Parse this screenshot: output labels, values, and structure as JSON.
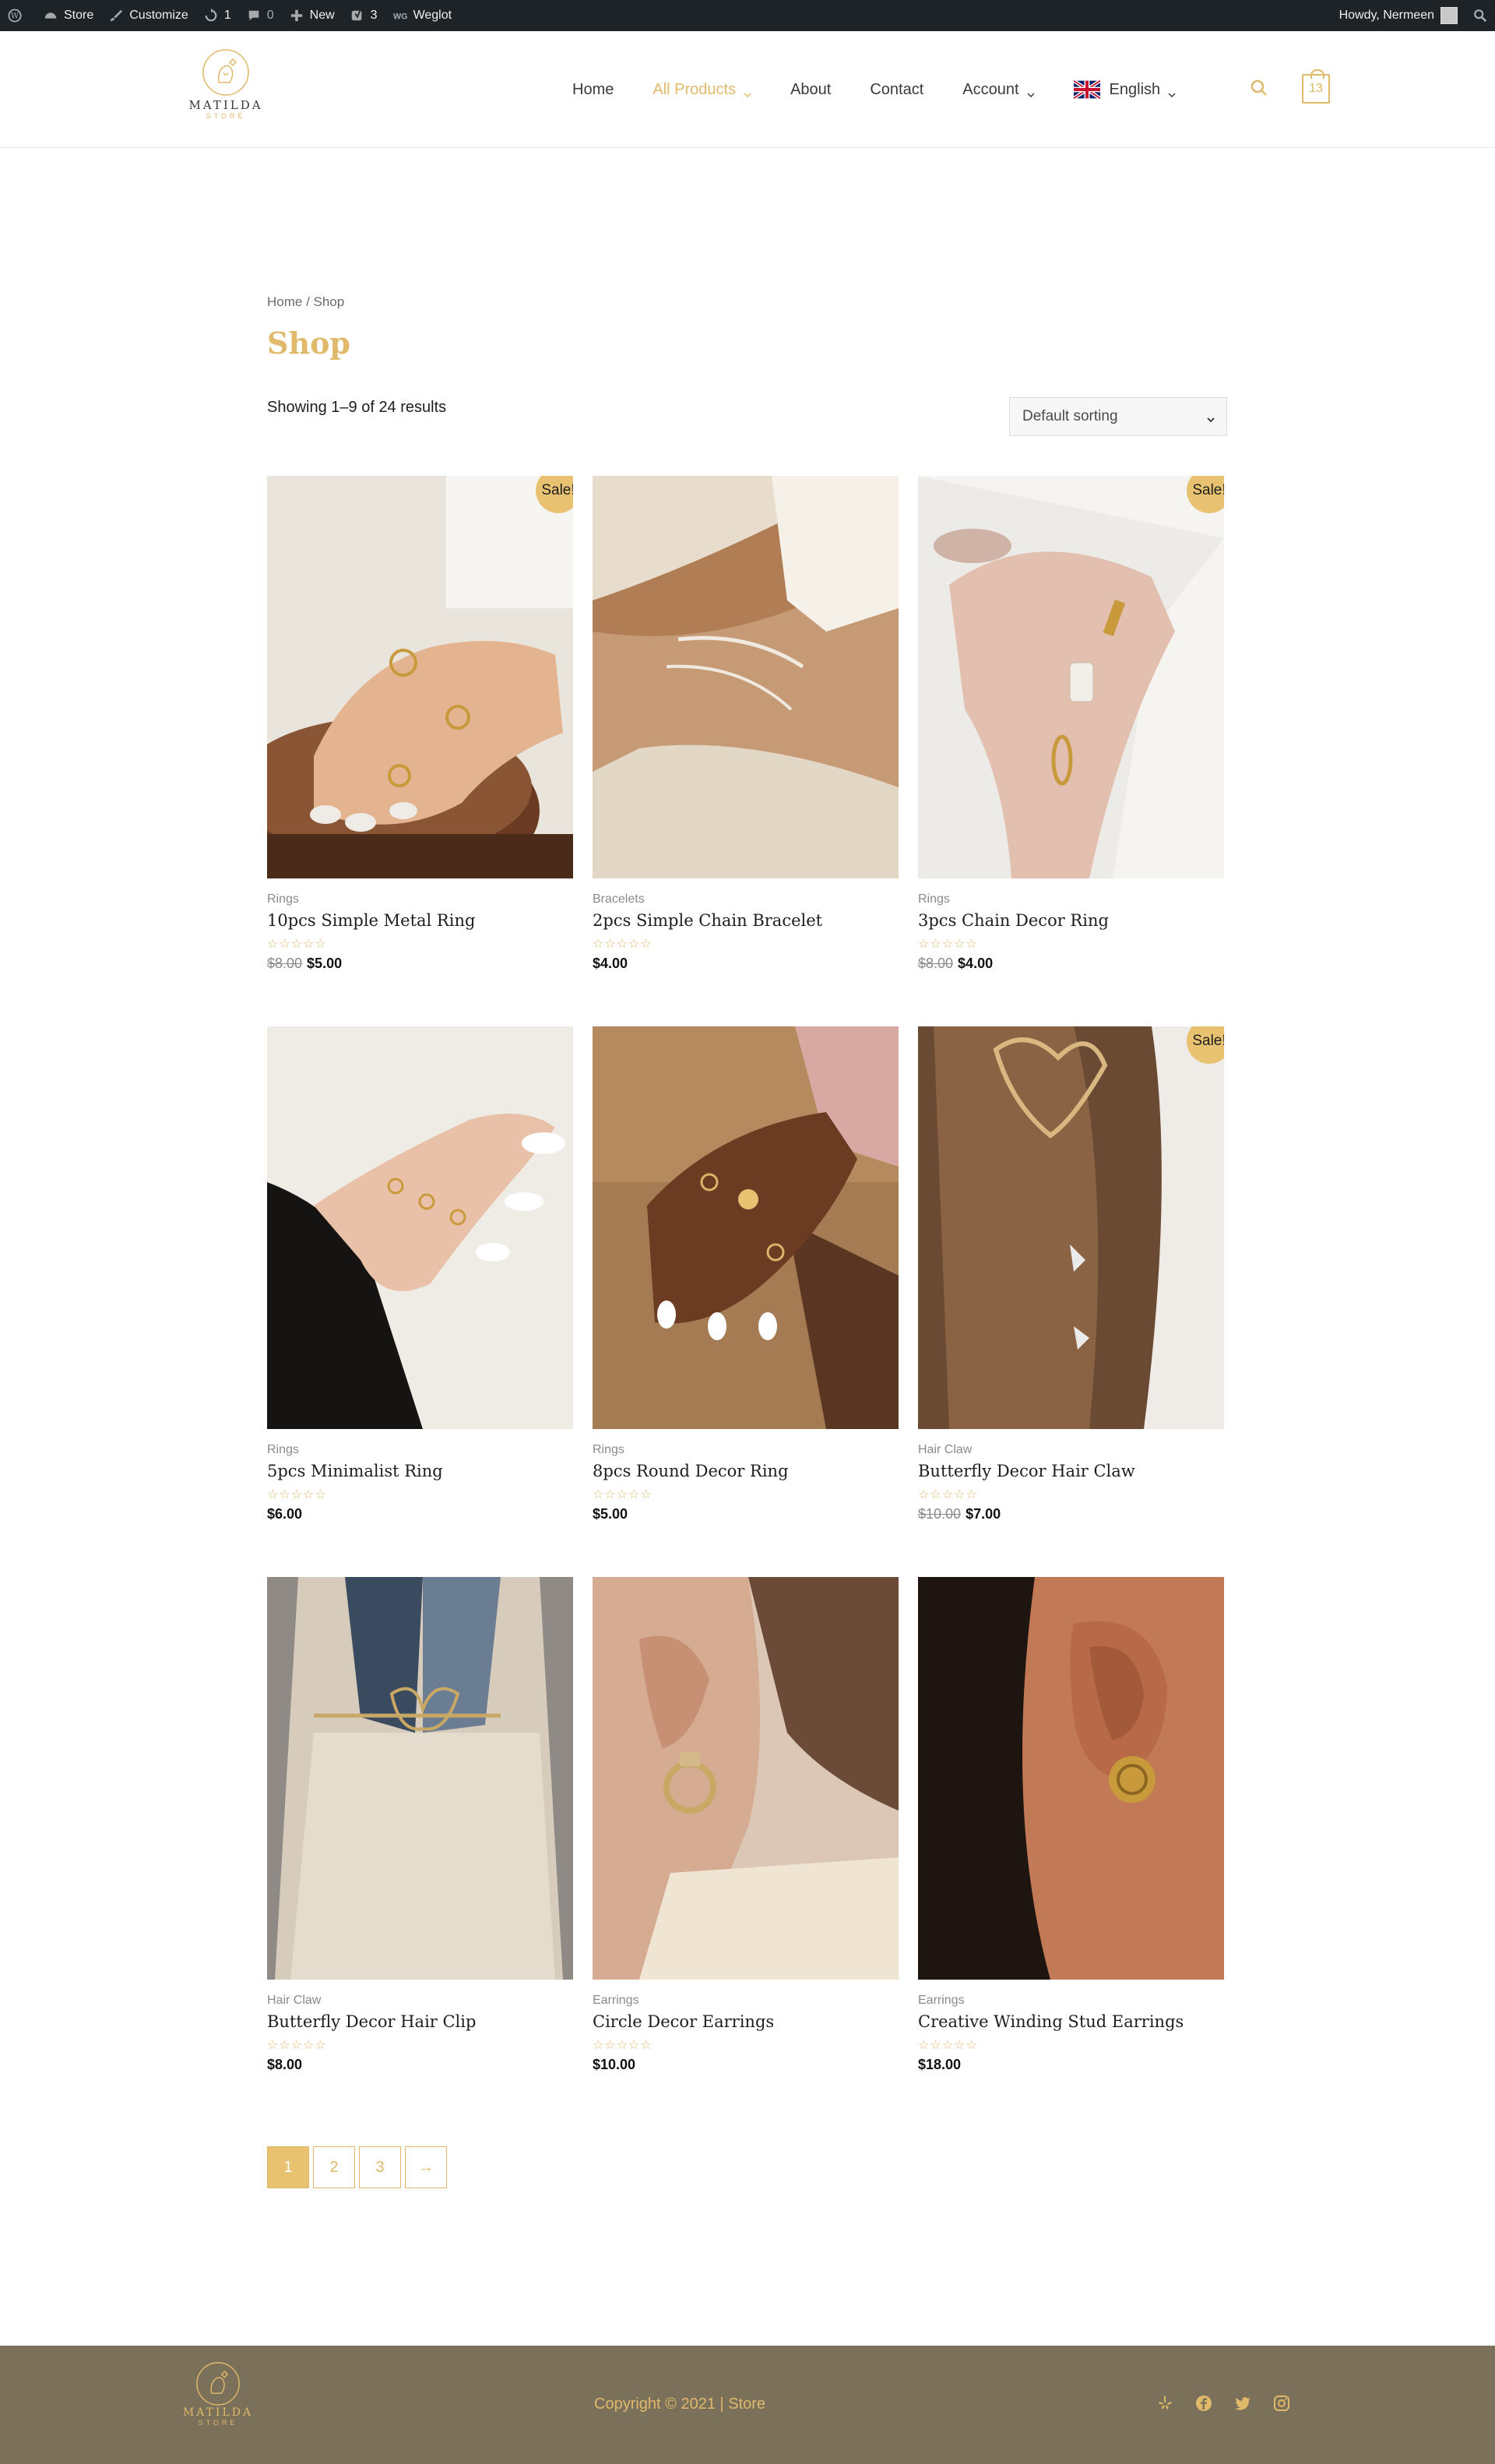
{
  "admin_bar": {
    "store": "Store",
    "customize": "Customize",
    "updates_count": "1",
    "comments_count": "0",
    "new_label": "New",
    "yoast_count": "3",
    "weglot": "Weglot",
    "howdy": "Howdy, Nermeen"
  },
  "header": {
    "logo_title": "MATILDA",
    "logo_subtitle": "STORE",
    "nav": {
      "home": "Home",
      "all_products": "All Products",
      "about": "About",
      "contact": "Contact",
      "account": "Account",
      "language": "English"
    },
    "cart_count": "13"
  },
  "main": {
    "breadcrumb": "Home / Shop",
    "title": "Shop",
    "result_count": "Showing 1–9 of 24 results",
    "sorting": "Default sorting"
  },
  "products": [
    {
      "category": "Rings",
      "name": "10pcs Simple Metal Ring",
      "old_price": "$8.00",
      "price": "$5.00",
      "sale": "Sale!",
      "rating": "☆☆☆☆☆"
    },
    {
      "category": "Bracelets",
      "name": "2pcs Simple Chain Bracelet",
      "old_price": "",
      "price": "$4.00",
      "sale": "",
      "rating": "☆☆☆☆☆"
    },
    {
      "category": "Rings",
      "name": "3pcs Chain Decor Ring",
      "old_price": "$8.00",
      "price": "$4.00",
      "sale": "Sale!",
      "rating": "☆☆☆☆☆"
    },
    {
      "category": "Rings",
      "name": "5pcs Minimalist Ring",
      "old_price": "",
      "price": "$6.00",
      "sale": "",
      "rating": "☆☆☆☆☆"
    },
    {
      "category": "Rings",
      "name": "8pcs Round Decor Ring",
      "old_price": "",
      "price": "$5.00",
      "sale": "",
      "rating": "☆☆☆☆☆"
    },
    {
      "category": "Hair Claw",
      "name": "Butterfly Decor Hair Claw",
      "old_price": "$10.00",
      "price": "$7.00",
      "sale": "Sale!",
      "rating": "☆☆☆☆☆"
    },
    {
      "category": "Hair Claw",
      "name": "Butterfly Decor Hair Clip",
      "old_price": "",
      "price": "$8.00",
      "sale": "",
      "rating": "☆☆☆☆☆"
    },
    {
      "category": "Earrings",
      "name": "Circle Decor Earrings",
      "old_price": "",
      "price": "$10.00",
      "sale": "",
      "rating": "☆☆☆☆☆"
    },
    {
      "category": "Earrings",
      "name": "Creative Winding Stud Earrings",
      "old_price": "",
      "price": "$18.00",
      "sale": "",
      "rating": "☆☆☆☆☆"
    }
  ],
  "pagination": {
    "p1": "1",
    "p2": "2",
    "p3": "3",
    "next": "→"
  },
  "footer": {
    "logo_title": "MATILDA",
    "logo_subtitle": "STORE",
    "copyright": "Copyright © 2021 | Store"
  },
  "colors": {
    "accent": "#e0b96a",
    "admin_bar": "#1d2327",
    "footer_bg": "#7b705a"
  }
}
